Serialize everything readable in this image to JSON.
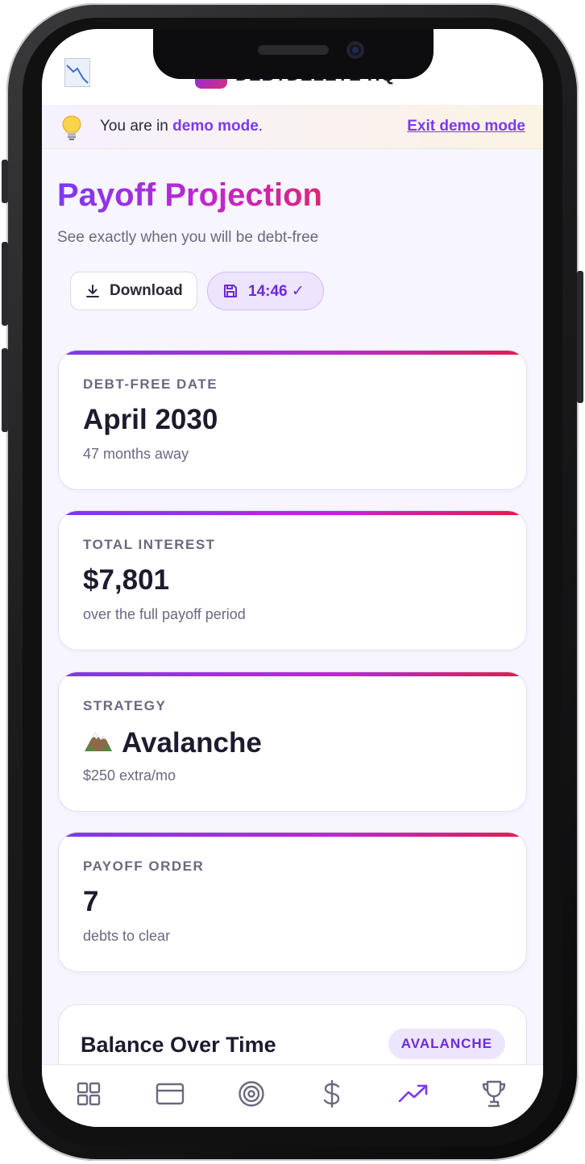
{
  "header": {
    "brand_name": "DEBTDELETE HQ"
  },
  "demo_banner": {
    "prefix": "You are in ",
    "highlight": "demo mode",
    "suffix": ".",
    "exit_label": "Exit demo mode"
  },
  "page": {
    "title": "Payoff Projection",
    "subtitle": "See exactly when you will be debt-free"
  },
  "actions": {
    "download_label": "Download",
    "saved_label": "14:46 ✓"
  },
  "cards": [
    {
      "label": "DEBT-FREE DATE",
      "value": "April 2030",
      "sub": "47 months away"
    },
    {
      "label": "TOTAL INTEREST",
      "value": "$7,801",
      "sub": "over the full payoff period"
    },
    {
      "label": "STRATEGY",
      "value": "Avalanche",
      "sub": "$250 extra/mo",
      "icon": "mountain-icon"
    },
    {
      "label": "PAYOFF ORDER",
      "value": "7",
      "sub": "debts to clear"
    }
  ],
  "chart_section": {
    "title": "Balance Over Time",
    "badge": "AVALANCHE"
  },
  "tabbar": {
    "items": [
      "dashboard-icon",
      "credit-card-icon",
      "target-icon",
      "dollar-icon",
      "trending-up-icon",
      "trophy-icon"
    ],
    "active": "trending-up-icon",
    "active_color": "#7c3aed",
    "inactive_color": "#6b6880"
  },
  "colors": {
    "accent": "#7c3aed",
    "accent_pink": "#db2777"
  }
}
